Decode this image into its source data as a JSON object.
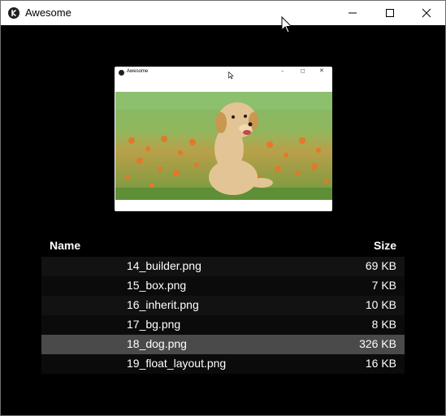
{
  "window": {
    "title": "Awesome",
    "controls": [
      "minimize-icon",
      "maximize-icon",
      "close-icon"
    ]
  },
  "preview": {
    "title": "Awesome",
    "image": "golden retriever puppy sitting in grass with orange flowers"
  },
  "file_list": {
    "columns": {
      "name": "Name",
      "size": "Size"
    },
    "rows": [
      {
        "name": "14_builder.png",
        "size": "69 KB"
      },
      {
        "name": "15_box.png",
        "size": "7 KB"
      },
      {
        "name": "16_inherit.png",
        "size": "10 KB"
      },
      {
        "name": "17_bg.png",
        "size": "8 KB"
      },
      {
        "name": "18_dog.png",
        "size": "326 KB",
        "selected": true
      },
      {
        "name": "19_float_layout.png",
        "size": "16 KB"
      }
    ]
  },
  "colors": {
    "background": "#000000",
    "selected_row": "#4a4a4a",
    "titlebar": "#ffffff"
  }
}
